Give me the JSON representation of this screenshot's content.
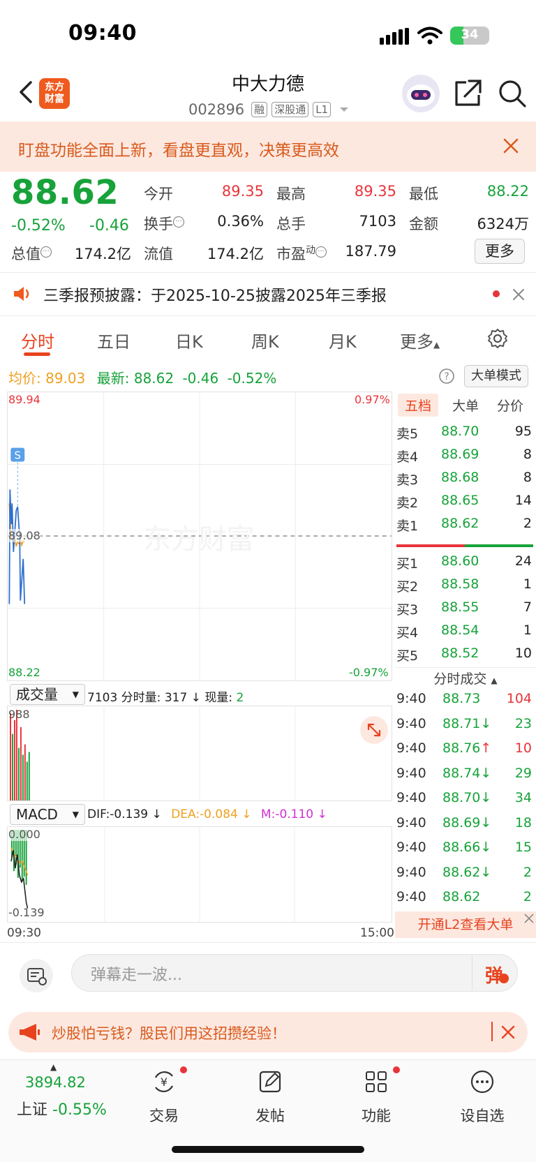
{
  "status": {
    "time": "09:40",
    "battery": "34",
    "battery_level": 0.34
  },
  "header": {
    "logo_line1": "东方",
    "logo_line2": "财富",
    "title": "中大力德",
    "code": "002896",
    "tags": [
      "融",
      "深股通",
      "L1"
    ]
  },
  "notice": {
    "text": "盯盘功能全面上新，看盘更直观，决策更高效"
  },
  "quote": {
    "price": "88.62",
    "change_pct": "-0.52%",
    "change": "-0.46",
    "open_label": "今开",
    "open": "89.35",
    "high_label": "最高",
    "high": "89.35",
    "low_label": "最低",
    "low": "88.22",
    "turnover_label": "换手",
    "turnover": "0.36%",
    "volume_label": "总手",
    "volume": "7103",
    "amount_label": "金额",
    "amount": "6324万",
    "mktcap_label": "总值",
    "mktcap": "174.2亿",
    "float_label": "流值",
    "float": "174.2亿",
    "pe_label": "市盈",
    "pe_sup": "动",
    "pe": "187.79",
    "more": "更多"
  },
  "announce": {
    "text": "三季报预披露：于2025-10-25披露2025年三季报"
  },
  "tabs": [
    "分时",
    "五日",
    "日K",
    "周K",
    "月K",
    "更多"
  ],
  "avg": {
    "avg_label": "均价:",
    "avg": "89.03",
    "last_label": "最新:",
    "last": "88.62",
    "change": "-0.46",
    "pct": "-0.52%",
    "big_mode": "大单模式"
  },
  "chart": {
    "top_price": "89.94",
    "top_pct": "0.97%",
    "mid_price": "89.08",
    "bottom_price": "88.22",
    "bottom_pct": "-0.97%",
    "watermark": "东方财富",
    "marker": "S",
    "start_time": "09:30",
    "end_time": "15:00"
  },
  "orderbook": {
    "tabs": [
      "五档",
      "大单",
      "分价"
    ],
    "asks": [
      {
        "label": "卖5",
        "price": "88.70",
        "vol": "95"
      },
      {
        "label": "卖4",
        "price": "88.69",
        "vol": "8"
      },
      {
        "label": "卖3",
        "price": "88.68",
        "vol": "8"
      },
      {
        "label": "卖2",
        "price": "88.65",
        "vol": "14"
      },
      {
        "label": "卖1",
        "price": "88.62",
        "vol": "2"
      }
    ],
    "bids": [
      {
        "label": "买1",
        "price": "88.60",
        "vol": "24"
      },
      {
        "label": "买2",
        "price": "88.58",
        "vol": "1"
      },
      {
        "label": "买3",
        "price": "88.55",
        "vol": "7"
      },
      {
        "label": "买4",
        "price": "88.54",
        "vol": "1"
      },
      {
        "label": "买5",
        "price": "88.52",
        "vol": "10"
      }
    ]
  },
  "ticks": {
    "title": "分时成交",
    "rows": [
      {
        "time": "9:40",
        "price": "88.73",
        "arrow": "",
        "vol": "104",
        "color": "#e8343a"
      },
      {
        "time": "9:40",
        "price": "88.71",
        "arrow": "↓",
        "vol": "23",
        "color": "#17a23a"
      },
      {
        "time": "9:40",
        "price": "88.76",
        "arrow": "↑",
        "vol": "10",
        "color": "#e8343a"
      },
      {
        "time": "9:40",
        "price": "88.74",
        "arrow": "↓",
        "vol": "29",
        "color": "#17a23a"
      },
      {
        "time": "9:40",
        "price": "88.70",
        "arrow": "↓",
        "vol": "34",
        "color": "#17a23a"
      },
      {
        "time": "9:40",
        "price": "88.69",
        "arrow": "↓",
        "vol": "18",
        "color": "#17a23a"
      },
      {
        "time": "9:40",
        "price": "88.66",
        "arrow": "↓",
        "vol": "15",
        "color": "#17a23a"
      },
      {
        "time": "9:40",
        "price": "88.62",
        "arrow": "↓",
        "vol": "2",
        "color": "#17a23a"
      },
      {
        "time": "9:40",
        "price": "88.62",
        "arrow": "",
        "vol": "2",
        "color": "#17a23a"
      }
    ],
    "l2": "开通L2查看大单"
  },
  "volume": {
    "selector": "成交量",
    "total": "7103",
    "minute_label": "分时量:",
    "minute": "317",
    "now_label": "现量:",
    "now": "2",
    "max": "988"
  },
  "macd": {
    "selector": "MACD",
    "dif": "DIF:-0.139",
    "dea": "DEA:-0.084",
    "m": "M:-0.110",
    "top": "0.000",
    "bottom": "-0.139"
  },
  "danmu": {
    "placeholder": "弹幕走一波...",
    "btn": "弹"
  },
  "promo": {
    "text": "炒股怕亏钱？股民们用这招攒经验！"
  },
  "nav": {
    "index_value": "3894.82",
    "index_name": "上证",
    "index_pct": "-0.55%",
    "trade": "交易",
    "post": "发帖",
    "func": "功能",
    "watch": "设自选"
  }
}
